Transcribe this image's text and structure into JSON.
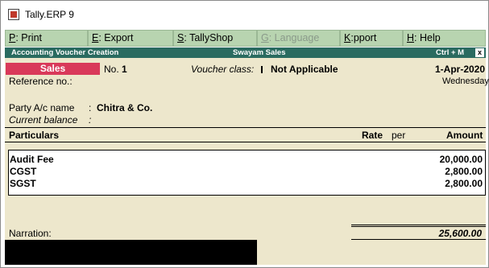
{
  "window": {
    "title": "Tally.ERP 9"
  },
  "menu": [
    {
      "key": "P",
      "rest": ": Print"
    },
    {
      "key": "E",
      "rest": ": Export"
    },
    {
      "key": "S",
      "rest": ": TallyShop"
    },
    {
      "key": "G",
      "rest": ": Language"
    },
    {
      "key": "K",
      "rest": ":pport Centre"
    },
    {
      "key": "H",
      "rest": ": Help"
    }
  ],
  "header": {
    "left": "Accounting Voucher  Creation",
    "center": "Swayam Sales",
    "right": "Ctrl + M",
    "close": "x"
  },
  "voucher": {
    "type": "Sales",
    "no_label": "No.",
    "no_value": "1",
    "class_label": "Voucher class:",
    "class_value": "Not Applicable",
    "date": "1-Apr-2020",
    "weekday": "Wednesday",
    "reference_label": "Reference no.:",
    "party_label": "Party A/c name",
    "party_value": "Chitra & Co.",
    "balance_label": "Current balance",
    "colon": ":"
  },
  "table": {
    "columns": {
      "particulars": "Particulars",
      "rate": "Rate",
      "per": "per",
      "amount": "Amount"
    },
    "rows": [
      {
        "particulars": "Audit Fee",
        "amount": "20,000.00"
      },
      {
        "particulars": "CGST",
        "amount": "2,800.00"
      },
      {
        "particulars": "SGST",
        "amount": "2,800.00"
      }
    ]
  },
  "narration": {
    "label": "Narration:",
    "total": "25,600.00"
  }
}
